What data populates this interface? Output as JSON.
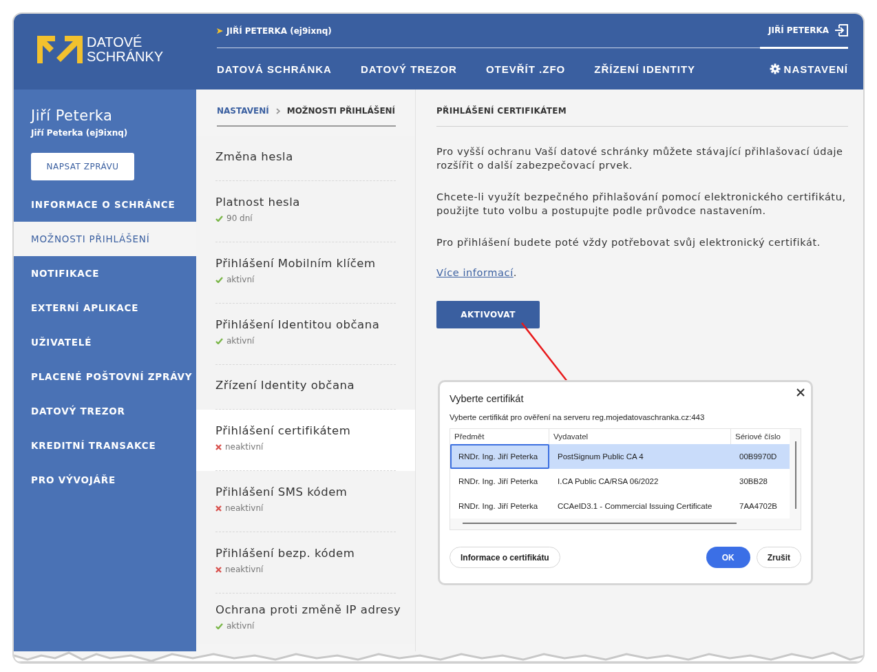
{
  "header": {
    "logo_lines": [
      "DATOVÉ",
      "SCHRÁNKY"
    ],
    "account": "JIŘÍ PETERKA (ej9ixnq)",
    "user": "JIŘÍ PETERKA",
    "nav": [
      {
        "label": "DATOVÁ SCHRÁNKA"
      },
      {
        "label": "DATOVÝ TREZOR"
      },
      {
        "label": "OTEVŘÍT .ZFO"
      },
      {
        "label": "ZŘÍZENÍ IDENTITY"
      }
    ],
    "settings": "NASTAVENÍ"
  },
  "sidebar": {
    "name": "Jiří Peterka",
    "subtitle": "Jiří Peterka (ej9ixnq)",
    "button": "NAPSAT ZPRÁVU",
    "items": [
      {
        "label": "INFORMACE O SCHRÁNCE",
        "selected": false
      },
      {
        "label": "MOŽNOSTI PŘIHLÁŠENÍ",
        "selected": true
      },
      {
        "label": "NOTIFIKACE",
        "selected": false
      },
      {
        "label": "EXTERNÍ APLIKACE",
        "selected": false
      },
      {
        "label": "UŽIVATELÉ",
        "selected": false
      },
      {
        "label": "PLACENÉ POŠTOVNÍ ZPRÁVY",
        "selected": false
      },
      {
        "label": "DATOVÝ TREZOR",
        "selected": false
      },
      {
        "label": "KREDITNÍ TRANSAKCE",
        "selected": false
      },
      {
        "label": "PRO VÝVOJÁŘE",
        "selected": false
      }
    ]
  },
  "breadcrumb": [
    "NASTAVENÍ",
    "MOŽNOSTI PŘIHLÁŠENÍ"
  ],
  "options": [
    {
      "title": "Změna hesla",
      "selected": false
    },
    {
      "title": "Platnost hesla",
      "status": "90 dní",
      "active": true,
      "selected": false
    },
    {
      "title": "Přihlášení Mobilním klíčem",
      "status": "aktivní",
      "active": true,
      "selected": false
    },
    {
      "title": "Přihlášení Identitou občana",
      "status": "aktivní",
      "active": true,
      "selected": false
    },
    {
      "title": "Zřízení Identity občana",
      "selected": false
    },
    {
      "title": "Přihlášení certifikátem",
      "status": "neaktivní",
      "active": false,
      "selected": true
    },
    {
      "title": "Přihlášení SMS kódem",
      "status": "neaktivní",
      "active": false,
      "selected": false
    },
    {
      "title": "Přihlášení bezp. kódem",
      "status": "neaktivní",
      "active": false,
      "selected": false
    },
    {
      "title": "Ochrana proti změně IP adresy",
      "status": "aktivní",
      "active": true,
      "selected": false
    }
  ],
  "detail": {
    "title": "PŘIHLÁŠENÍ CERTIFIKÁTEM",
    "paragraphs": [
      "Pro vyšší ochranu Vaší datové schránky můžete stávající přihlašovací údaje rozšířit o další zabezpečovací prvek.",
      "Chcete-li využít bezpečného přihlašování pomocí elektronického certifikátu, použijte tuto volbu a postupujte podle průvodce nastavením.",
      "Pro přihlášení budete poté vždy potřebovat svůj elektronický certifikát."
    ],
    "link": "Více informací",
    "link_after": ".",
    "button": "AKTIVOVAT"
  },
  "dialog": {
    "title": "Vyberte certifikát",
    "subtitle": "Vyberte certifikát pro ověření na serveru reg.mojedatovaschranka.cz:443",
    "columns": [
      "Předmět",
      "Vydavatel",
      "Sériové číslo"
    ],
    "rows": [
      {
        "subject": "RNDr. Ing. Jiří Peterka",
        "issuer": "PostSignum Public CA 4",
        "serial": "00B9970D",
        "selected": true
      },
      {
        "subject": "RNDr. Ing. Jiří Peterka",
        "issuer": "I.CA Public CA/RSA 06/2022",
        "serial": "30BB28",
        "selected": false
      },
      {
        "subject": "RNDr. Ing. Jiří Peterka",
        "issuer": "CCAeID3.1 - Commercial Issuing Certificate",
        "serial": "7AA4702B",
        "selected": false
      }
    ],
    "info_button": "Informace o certifikátu",
    "ok_button": "OK",
    "cancel_button": "Zrušit"
  }
}
